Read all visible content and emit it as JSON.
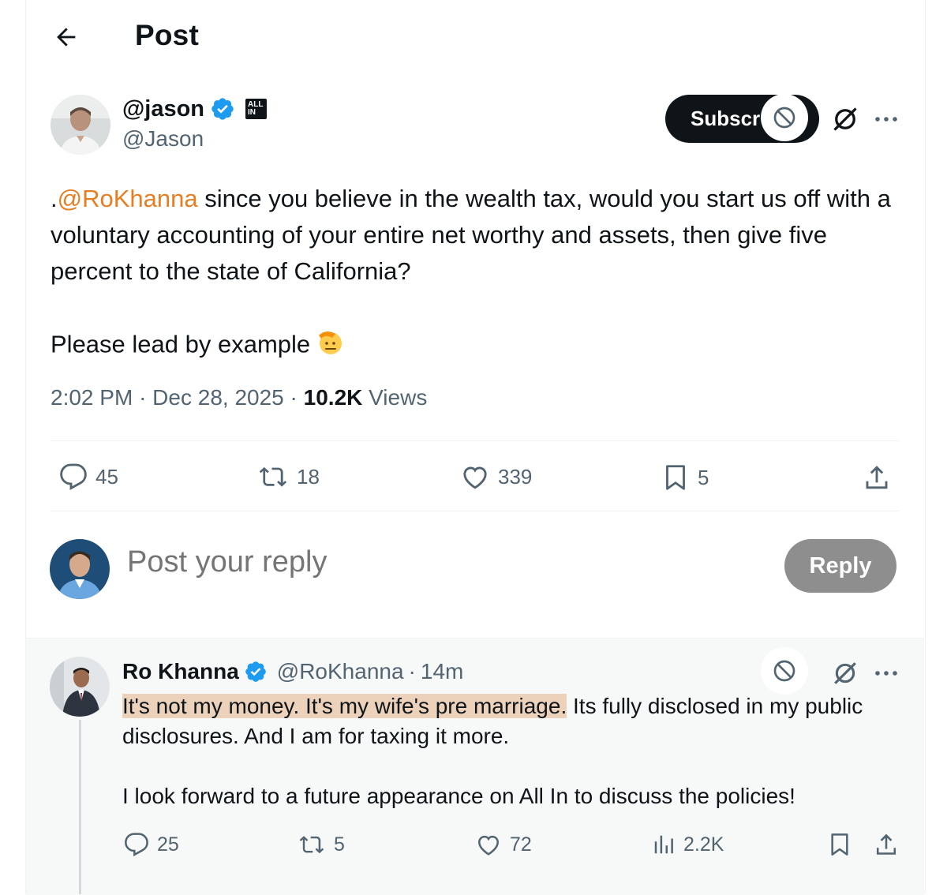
{
  "header": {
    "title": "Post"
  },
  "post": {
    "author_name": "@jason",
    "author_handle": "@Jason",
    "affiliate_badge": [
      "ALL",
      "IN"
    ],
    "subscribe_label": "Subscr",
    "mention": "@RoKhanna",
    "text_prefix": ".",
    "text_body": " since you believe in the wealth tax, would you start us off with a voluntary accounting of your entire net worthy and assets, then give five percent to the state of California?\n\nPlease lead by example",
    "time": "2:02 PM",
    "date": "Dec 28, 2025",
    "views_count": "10.2K",
    "views_label": "Views",
    "separator": "·",
    "stats": {
      "replies": "45",
      "reposts": "18",
      "likes": "339",
      "bookmarks": "5"
    }
  },
  "composer": {
    "placeholder": "Post your reply",
    "reply_button": "Reply"
  },
  "reply": {
    "author_name": "Ro Khanna",
    "author_handle": "@RoKhanna",
    "separator": "·",
    "time": "14m",
    "text_highlighted": "It's not my money. It's my wife's pre marriage.",
    "text_rest": " Its fully disclosed in my public disclosures. And I am for taxing it more.\n\nI look forward to a future appearance on All In to discuss the policies!",
    "stats": {
      "replies": "25",
      "reposts": "5",
      "likes": "72",
      "views": "2.2K"
    }
  },
  "colors": {
    "mention": "#e67e22",
    "highlight": "#ecd2bb",
    "verified": "#1d9bf0",
    "muted": "#536471"
  }
}
